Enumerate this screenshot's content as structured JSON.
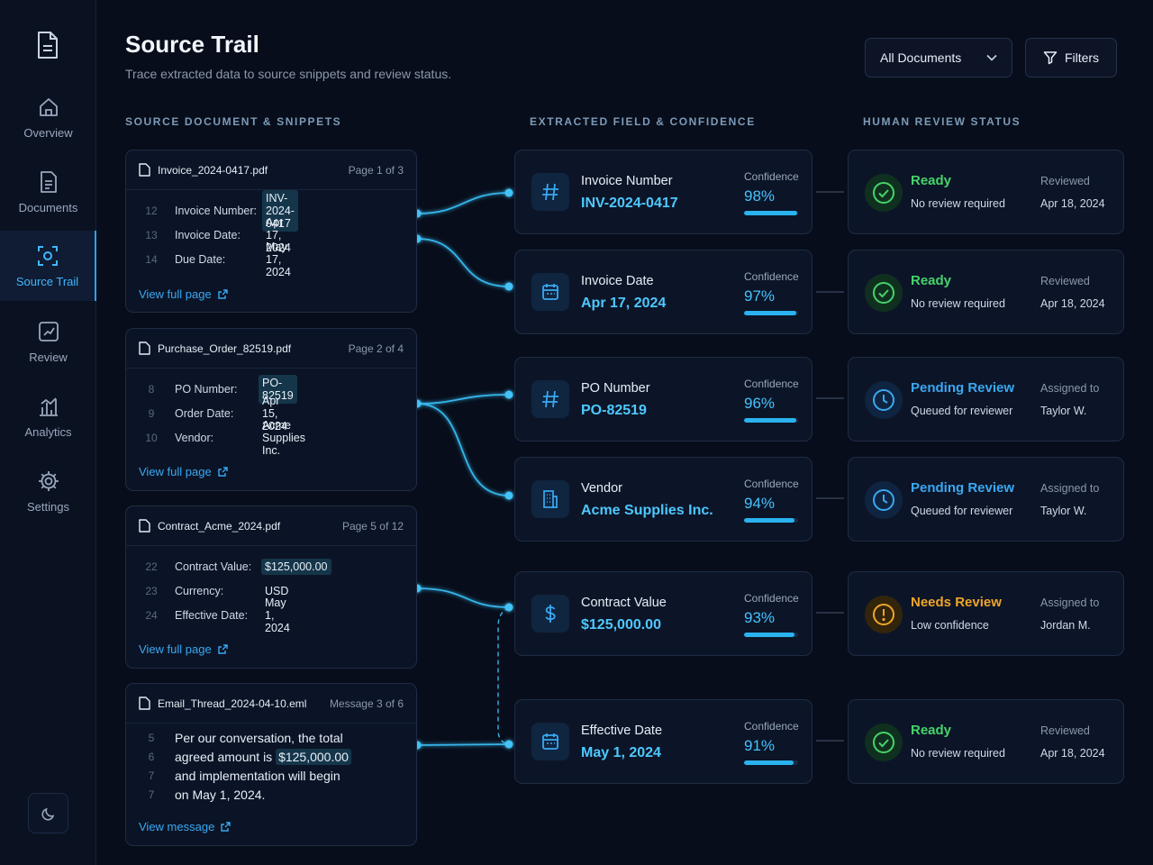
{
  "sidebar": {
    "items": [
      {
        "label": "Overview",
        "icon": "home-icon",
        "active": false
      },
      {
        "label": "Documents",
        "icon": "document-icon",
        "active": false
      },
      {
        "label": "Source Trail",
        "icon": "source-trail-icon",
        "active": true
      },
      {
        "label": "Review",
        "icon": "review-icon",
        "active": false
      },
      {
        "label": "Analytics",
        "icon": "analytics-icon",
        "active": false
      },
      {
        "label": "Settings",
        "icon": "gear-icon",
        "active": false
      }
    ]
  },
  "header": {
    "title": "Source Trail",
    "subtitle": "Trace extracted data to source snippets and review status.",
    "doc_filter": "All Documents",
    "filters_label": "Filters"
  },
  "columns": {
    "source": "SOURCE DOCUMENT & SNIPPETS",
    "field": "EXTRACTED FIELD & CONFIDENCE",
    "review": "HUMAN REVIEW STATUS"
  },
  "sources": [
    {
      "file": "Invoice_2024-0417.pdf",
      "page": "Page 1 of 3",
      "rows": [
        {
          "ln": "12",
          "key": "Invoice Number:",
          "val": "INV-2024-0417",
          "hl": true
        },
        {
          "ln": "13",
          "key": "Invoice Date:",
          "val": "Apr 17, 2024",
          "hl": false
        },
        {
          "ln": "14",
          "key": "Due Date:",
          "val": "May 17, 2024",
          "hl": false
        }
      ],
      "link": "View full page"
    },
    {
      "file": "Purchase_Order_82519.pdf",
      "page": "Page 2 of 4",
      "rows": [
        {
          "ln": "8",
          "key": "PO Number:",
          "val": "PO-82519",
          "hl": true
        },
        {
          "ln": "9",
          "key": "Order Date:",
          "val": "Apr 15, 2024",
          "hl": false
        },
        {
          "ln": "10",
          "key": "Vendor:",
          "val": "Acme Supplies Inc.",
          "hl": false
        }
      ],
      "link": "View full page"
    },
    {
      "file": "Contract_Acme_2024.pdf",
      "page": "Page 5 of 12",
      "rows": [
        {
          "ln": "22",
          "key": "Contract Value:",
          "val": "$125,000.00",
          "hl": true
        },
        {
          "ln": "23",
          "key": "Currency:",
          "val": "USD",
          "hl": false
        },
        {
          "ln": "24",
          "key": "Effective Date:",
          "val": "May 1, 2024",
          "hl": false
        }
      ],
      "link": "View full page"
    },
    {
      "file": "Email_Thread_2024-04-10.eml",
      "page": "Message 3 of 6",
      "lines": [
        {
          "ln": "5",
          "pre": "Per our conversation, the total",
          "hl": "",
          "post": ""
        },
        {
          "ln": "6",
          "pre": "agreed amount is ",
          "hl": "$125,000.00",
          "post": ""
        },
        {
          "ln": "7",
          "pre": "and implementation will begin",
          "hl": "",
          "post": ""
        },
        {
          "ln": "7",
          "pre": "on May 1, 2024.",
          "hl": "",
          "post": ""
        }
      ],
      "link": "View message"
    }
  ],
  "fields": [
    {
      "label": "Invoice Number",
      "value": "INV-2024-0417",
      "icon": "hash-icon",
      "conf_label": "Confidence",
      "conf": "98%",
      "conf_pct": 98
    },
    {
      "label": "Invoice Date",
      "value": "Apr 17, 2024",
      "icon": "calendar-icon",
      "conf_label": "Confidence",
      "conf": "97%",
      "conf_pct": 97
    },
    {
      "label": "PO Number",
      "value": "PO-82519",
      "icon": "hash-icon",
      "conf_label": "Confidence",
      "conf": "96%",
      "conf_pct": 96
    },
    {
      "label": "Vendor",
      "value": "Acme Supplies Inc.",
      "icon": "building-icon",
      "conf_label": "Confidence",
      "conf": "94%",
      "conf_pct": 94
    },
    {
      "label": "Contract Value",
      "value": "$125,000.00",
      "icon": "dollar-icon",
      "conf_label": "Confidence",
      "conf": "93%",
      "conf_pct": 93
    },
    {
      "label": "Effective Date",
      "value": "May 1, 2024",
      "icon": "calendar-icon",
      "conf_label": "Confidence",
      "conf": "91%",
      "conf_pct": 91
    }
  ],
  "reviews": [
    {
      "status": "Ready",
      "kind": "ok",
      "sub": "No review required",
      "meta_label": "Reviewed",
      "meta_value": "Apr 18, 2024"
    },
    {
      "status": "Ready",
      "kind": "ok",
      "sub": "No review required",
      "meta_label": "Reviewed",
      "meta_value": "Apr 18, 2024"
    },
    {
      "status": "Pending Review",
      "kind": "pend",
      "sub": "Queued for reviewer",
      "meta_label": "Assigned to",
      "meta_value": "Taylor W."
    },
    {
      "status": "Pending Review",
      "kind": "pend",
      "sub": "Queued for reviewer",
      "meta_label": "Assigned to",
      "meta_value": "Taylor W."
    },
    {
      "status": "Needs Review",
      "kind": "warn",
      "sub": "Low confidence",
      "meta_label": "Assigned to",
      "meta_value": "Jordan M."
    },
    {
      "status": "Ready",
      "kind": "ok",
      "sub": "No review required",
      "meta_label": "Reviewed",
      "meta_value": "Apr 18, 2024"
    }
  ],
  "colors": {
    "accent": "#3aa8f2",
    "ok": "#46d36b",
    "warn": "#f0a52a",
    "bg": "#070d1a"
  }
}
